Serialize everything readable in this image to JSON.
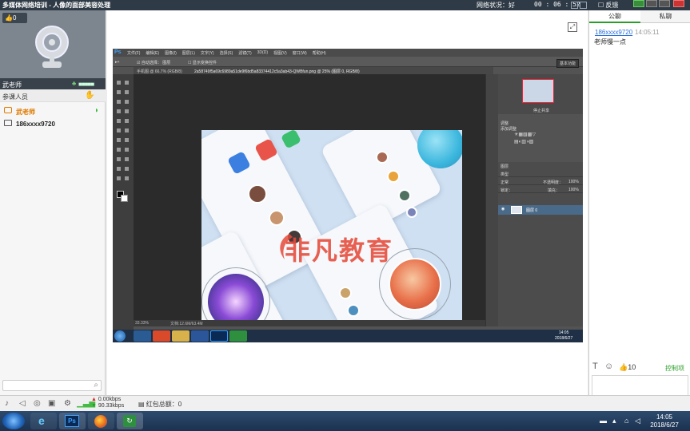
{
  "titlebar": {
    "title": "多媒体网络培训 - 人像的面部美容处理",
    "network_status": "网络状况：好",
    "timer": "00 : 06 : 52",
    "feedback": "反馈"
  },
  "left_panel": {
    "like_count": "0",
    "teacher_name": "武老师",
    "participants_label": "参课人员",
    "members": [
      {
        "name": "武老师",
        "role": "teacher"
      },
      {
        "name": "186xxxx9720",
        "role": "student"
      }
    ],
    "search_placeholder": ""
  },
  "photoshop": {
    "logo": "Ps",
    "menus": [
      "文件(F)",
      "编辑(E)",
      "图像(I)",
      "图层(L)",
      "文字(Y)",
      "选择(S)",
      "滤镜(T)",
      "3D(D)",
      "视图(V)",
      "窗口(W)",
      "帮助(H)"
    ],
    "options": {
      "auto_select": "自动选择：",
      "layer_dropdown": "图层",
      "transform": "显示变换控件",
      "workspace": "基本功能"
    },
    "tabs": [
      "手机图 @ 66.7% (RGB/8)",
      "2a58749f5a69c6989a51de9f6bd5a83374412c5a3ab43-QWBfun.png @ 25% (图层 0, RGB/8)"
    ],
    "status": {
      "zoom": "33.33%",
      "doc": "文档:12.6M/63.4M"
    },
    "navigator_label": "停止共享",
    "adjustments_title": "调整",
    "adjustments_sub": "添加调整",
    "layers_title": "图层",
    "layer_kind": "类型",
    "blend_mode": "正常",
    "opacity_label": "不透明度：",
    "opacity_value": "100%",
    "lock_label": "锁定：",
    "fill_label": "填充：",
    "fill_value": "100%",
    "selected_layer": "图层 0",
    "inner_clock": {
      "time": "14:05",
      "date": "2018/6/27"
    }
  },
  "artwork": {
    "brand_text": "非凡教育"
  },
  "right_panel": {
    "tab_public": "公聊",
    "tab_private": "私聊",
    "messages": [
      {
        "user": "186xxxx9720",
        "time": "14:05:11",
        "text": "老师慢一点"
      }
    ],
    "like_count": "10",
    "control_label": "控制项"
  },
  "statusbar": {
    "upload_speed": "0.00kbps",
    "download_speed": "90.33kbps",
    "red_packet": "红包总额：0"
  },
  "taskbar": {
    "time": "14:05",
    "date": "2018/6/27"
  },
  "colors": {
    "accent_green": "#2a9d2a",
    "teacher_orange": "#e07a00",
    "link_blue": "#2b6fd6",
    "brand_red": "#e64a3a"
  }
}
